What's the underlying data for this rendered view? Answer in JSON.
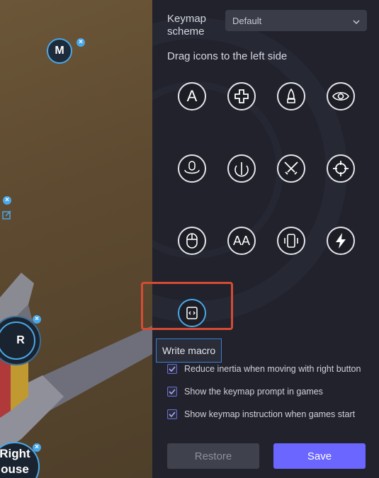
{
  "keymap": {
    "scheme_label": "Keymap scheme",
    "scheme_value": "Default",
    "drag_hint": "Drag icons to the left side"
  },
  "icons": [
    {
      "name": "text-a-icon",
      "label": "A"
    },
    {
      "name": "dpad-icon"
    },
    {
      "name": "fire-icon"
    },
    {
      "name": "eye-icon"
    },
    {
      "name": "mouse-rotate-icon"
    },
    {
      "name": "rotate-icon"
    },
    {
      "name": "swords-icon"
    },
    {
      "name": "crosshair-icon"
    },
    {
      "name": "mouse-icon"
    },
    {
      "name": "text-aa-icon",
      "label": "AA"
    },
    {
      "name": "phone-rotate-icon"
    },
    {
      "name": "lightning-icon"
    },
    {
      "name": "macro-script-icon"
    }
  ],
  "tooltip": "Write macro",
  "options": [
    {
      "label": "Reduce inertia when moving with right button",
      "checked": true
    },
    {
      "label": "Show the keymap prompt in games",
      "checked": true
    },
    {
      "label": "Show keymap instruction when games start",
      "checked": true
    }
  ],
  "buttons": {
    "restore": "Restore",
    "save": "Save"
  },
  "game": {
    "m_key": "M",
    "r_key": "R",
    "right_mouse_line1": "Right",
    "right_mouse_line2": "ouse"
  },
  "colors": {
    "accent": "#6a66ff",
    "highlight": "#d64b34",
    "badge": "#4aa8e8"
  }
}
